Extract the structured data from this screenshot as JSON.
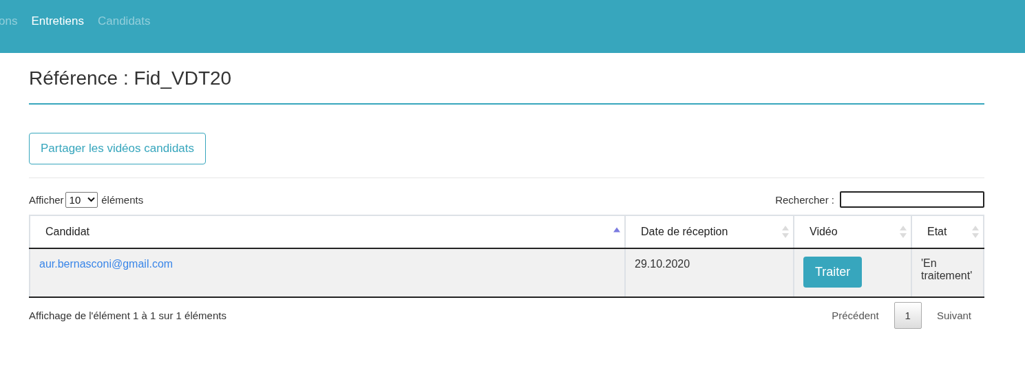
{
  "nav": {
    "items": [
      {
        "label": "ons",
        "selected": false
      },
      {
        "label": "Entretiens",
        "selected": true
      },
      {
        "label": "Candidats",
        "selected": false
      }
    ]
  },
  "title": "Référence : Fid_VDT20",
  "share_button": "Partager les vidéos candidats",
  "length": {
    "before": "Afficher",
    "value": "10",
    "after": "éléments"
  },
  "search": {
    "label": "Rechercher :"
  },
  "table": {
    "columns": [
      {
        "label": "Candidat",
        "sorted": true
      },
      {
        "label": "Date de réception",
        "sorted": false
      },
      {
        "label": "Vidéo",
        "sorted": false
      },
      {
        "label": "Etat",
        "sorted": false
      }
    ],
    "rows": [
      {
        "candidate": "aur.bernasconi@gmail.com",
        "date": "29.10.2020",
        "action": "Traiter",
        "state": "'En traitement'"
      }
    ]
  },
  "info": "Affichage de l'élément 1 à 1 sur 1 éléments",
  "pagination": {
    "previous": "Précédent",
    "pages": [
      {
        "label": "1",
        "selected": true
      }
    ],
    "next": "Suivant"
  }
}
